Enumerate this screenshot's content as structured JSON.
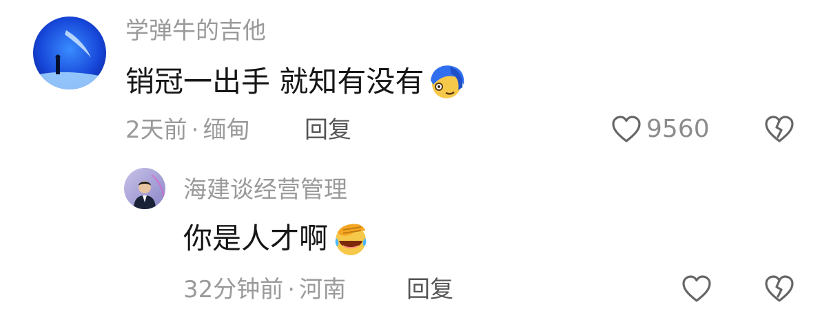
{
  "comments": [
    {
      "username": "学弹牛的吉他",
      "text": "销冠一出手 就知有没有",
      "emoji_icon": "smirk-face-blue-hair-icon",
      "time": "2天前",
      "location": "缅甸",
      "reply_label": "回复",
      "like_count": "9560"
    },
    {
      "username": "海建谈经营管理",
      "text": "你是人才啊",
      "emoji_icon": "laughing-facepalm-icon",
      "time": "32分钟前",
      "location": "河南",
      "reply_label": "回复",
      "like_count": ""
    }
  ],
  "separator": "·",
  "colors": {
    "meta_gray": "#9a9a9a",
    "text_dark": "#161616",
    "icon_gray": "#666666"
  }
}
